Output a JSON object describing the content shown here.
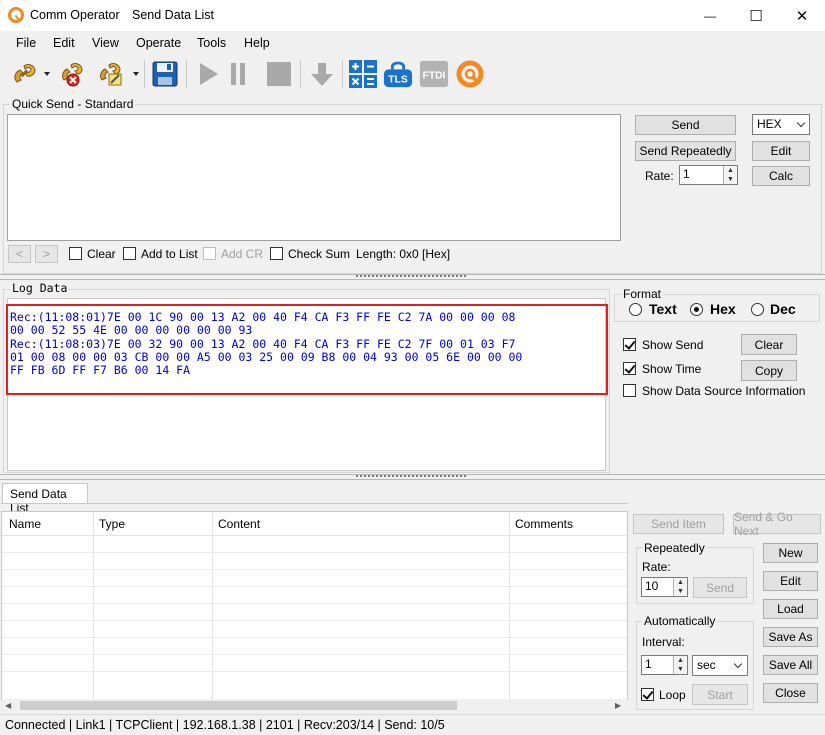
{
  "app": {
    "title": "Comm Operator",
    "subtitle": "Send Data List"
  },
  "window_controls": {
    "minimize": "—",
    "maximize": "☐",
    "close": "✕"
  },
  "menu": [
    "File",
    "Edit",
    "View",
    "Operate",
    "Tools",
    "Help"
  ],
  "toolbar": {
    "icons": [
      "connect-icon",
      "disconnect-icon",
      "edit-connection-icon",
      "save-icon",
      "start-icon",
      "pause-icon",
      "stop-icon",
      "download-icon",
      "calculator-icon",
      "tls-icon",
      "ftdi-icon",
      "comm-operator-icon"
    ],
    "tls_label": "TLS",
    "ftdi_label": "FTDI"
  },
  "quick_send": {
    "group_title": "Quick Send - Standard",
    "send_label": "Send",
    "send_repeatedly_label": "Send Repeatedly",
    "rate_label": "Rate:",
    "rate_value": "1",
    "format_value": "HEX",
    "edit_label": "Edit",
    "calc_label": "Calc",
    "prev_label": "<",
    "next_label": ">",
    "clear_label": "Clear",
    "add_to_list_label": "Add to List",
    "add_cr_label": "Add CR",
    "check_sum_label": "Check Sum",
    "length_text": "Length: 0x0 [Hex]"
  },
  "log_data": {
    "group_title": "Log Data",
    "lines": [
      "Rec:(11:08:01)7E 00 1C 90 00 13 A2 00 40 F4 CA F3 FF FE C2 7A 00 00 00 08",
      "00 00 52 55 4E 00 00 00 00 00 00 93",
      "Rec:(11:08:03)7E 00 32 90 00 13 A2 00 40 F4 CA F3 FF FE C2 7F 00 01 03 F7",
      "01 00 08 00 00 03 CB 00 00 A5 00 03 25 00 09 B8 00 04 93 00 05 6E 00 00 00",
      "FF FB 6D FF F7 B6 00 14 FA"
    ],
    "highlight_color": "#e02020"
  },
  "format": {
    "group_title": "Format",
    "text_label": "Text",
    "hex_label": "Hex",
    "dec_label": "Dec",
    "selected": "Hex",
    "show_send_label": "Show Send",
    "show_time_label": "Show Time",
    "show_data_source_label": "Show Data Source Information",
    "show_send": true,
    "show_time": true,
    "show_data_source": false,
    "clear_label": "Clear",
    "copy_label": "Copy"
  },
  "send_data_list": {
    "tab_label": "Send Data List",
    "columns": [
      "Name",
      "Type",
      "Content",
      "Comments"
    ],
    "send_item_label": "Send Item",
    "send_go_next_label": "Send & Go Next",
    "repeatedly_title": "Repeatedly",
    "rate_label": "Rate:",
    "rate_value": "10",
    "send_label": "Send",
    "automatically_title": "Automatically",
    "interval_label": "Interval:",
    "interval_value": "1",
    "interval_unit": "sec",
    "loop_label": "Loop",
    "loop_checked": true,
    "start_label": "Start",
    "new_label": "New",
    "edit_label": "Edit",
    "load_label": "Load",
    "save_as_label": "Save As",
    "save_all_label": "Save All",
    "close_label": "Close"
  },
  "status_bar": {
    "text": "Connected | Link1 | TCPClient | 192.168.1.38 | 2101 | Recv:203/14 | Send: 10/5"
  },
  "colors": {
    "accent_orange": "#f08a24",
    "icon_blue": "#1a73c8",
    "log_text": "#0000d0"
  }
}
